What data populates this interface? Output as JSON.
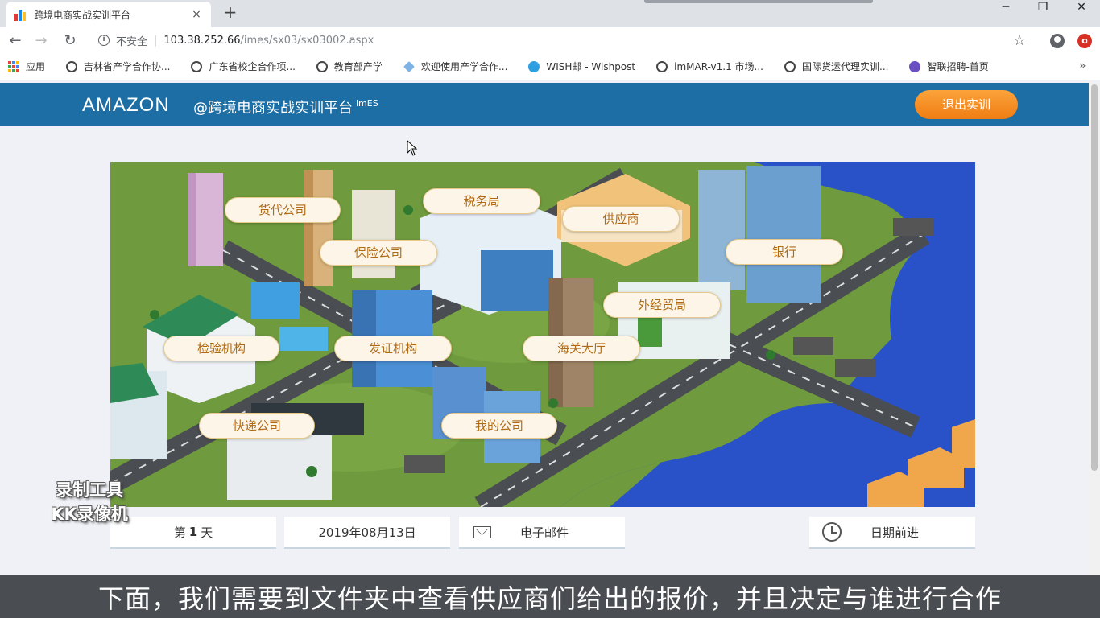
{
  "browser": {
    "tab_title": "跨境电商实战实训平台",
    "tab_close": "×",
    "new_tab": "+",
    "security_label": "不安全",
    "url_host": "103.38.252.66",
    "url_path": "/imes/sx03/sx03002.aspx",
    "bookmarks": [
      {
        "label": "应用",
        "icon": "apps-grid-icon"
      },
      {
        "label": "吉林省产学合作协...",
        "icon": "globe-icon"
      },
      {
        "label": "广东省校企合作项...",
        "icon": "globe-icon"
      },
      {
        "label": "教育部产学",
        "icon": "globe-icon"
      },
      {
        "label": "欢迎使用产学合作...",
        "icon": "diamond-icon"
      },
      {
        "label": "WISH邮 - Wishpost",
        "icon": "wish-icon"
      },
      {
        "label": "imMAR-v1.1 市场...",
        "icon": "globe-icon"
      },
      {
        "label": "国际货运代理实训...",
        "icon": "globe-icon"
      },
      {
        "label": "智联招聘-首页",
        "icon": "zhaopin-icon"
      }
    ],
    "bookmarks_more": "»"
  },
  "header": {
    "brand": "AMAZON",
    "subtitle": "@跨境电商实战实训平台",
    "subtitle_sup": "imES",
    "logout_label": "退出实训"
  },
  "map_locations": {
    "freight": "货代公司",
    "tax": "税务局",
    "supplier": "供应商",
    "insurance": "保险公司",
    "bank": "银行",
    "trade_bureau": "外经贸局",
    "inspection": "检验机构",
    "certificate": "发证机构",
    "customs": "海关大厅",
    "courier": "快递公司",
    "my_company": "我的公司"
  },
  "status": {
    "day_prefix": "第",
    "day_number": "1",
    "day_suffix": "天",
    "date": "2019年08月13日",
    "email_label": "电子邮件",
    "advance_label": "日期前进"
  },
  "watermark": {
    "line1": "录制工具",
    "line2": "KK录像机"
  },
  "caption": "下面，我们需要到文件夹中查看供应商们给出的报价，并且决定与谁进行合作",
  "colors": {
    "header_blue": "#1c6ea4",
    "logout_orange": "#f3901f",
    "label_text": "#b06a14",
    "water": "#2a52c8",
    "grass": "#6f9a3e"
  }
}
